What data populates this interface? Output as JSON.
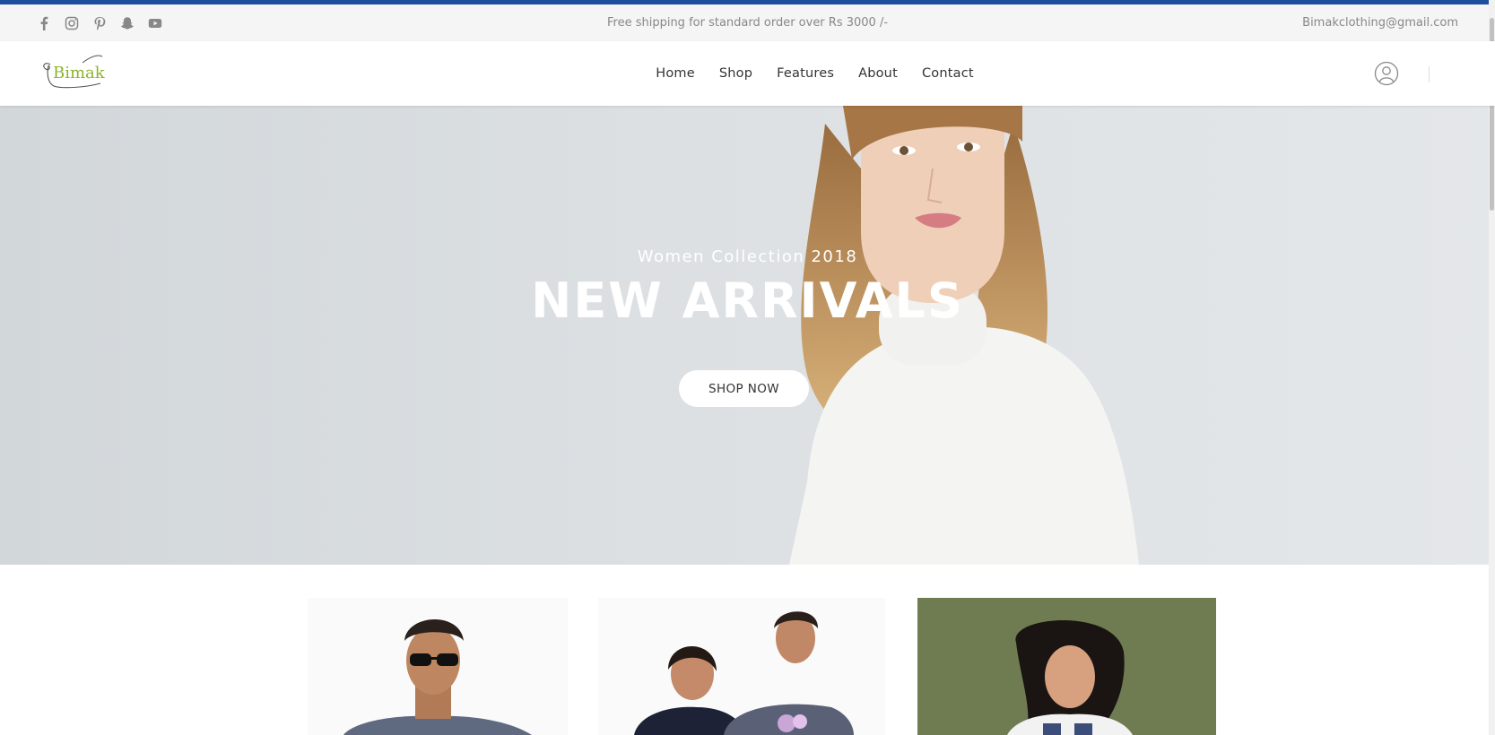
{
  "topbar": {
    "shipping_text": "Free shipping for standard order over Rs 3000 /-",
    "email": "Bimakclothing@gmail.com",
    "social_icons": [
      "facebook-icon",
      "instagram-icon",
      "pinterest-icon",
      "snapchat-icon",
      "youtube-icon"
    ]
  },
  "header": {
    "logo_text": "Bimak",
    "nav": [
      {
        "label": "Home"
      },
      {
        "label": "Shop"
      },
      {
        "label": "Features"
      },
      {
        "label": "About"
      },
      {
        "label": "Contact"
      }
    ]
  },
  "hero": {
    "subtitle": "Women Collection 2018",
    "title": "NEW ARRIVALS",
    "button_label": "SHOP NOW"
  },
  "colors": {
    "top_accent": "#1c4f9c",
    "topbar_bg": "#f5f5f5",
    "logo_green": "#8db32b",
    "hero_bg": "#d8dcdf",
    "banner3_bg": "#6f7c52"
  }
}
